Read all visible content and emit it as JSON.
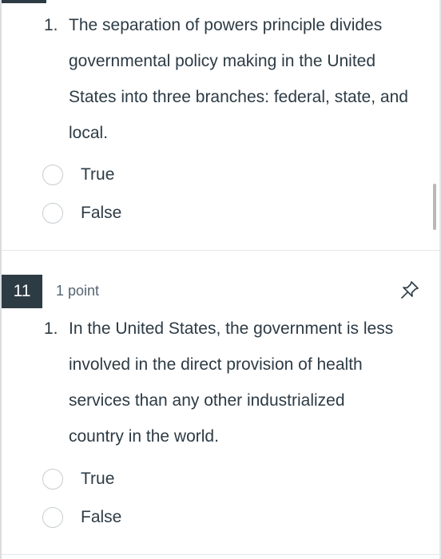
{
  "questions": [
    {
      "item_number": "1.",
      "lines": [
        "The separation of powers principle divides",
        "governmental policy making in the United",
        "States into three branches: federal, state, and",
        "local."
      ],
      "options": [
        "True",
        "False"
      ]
    },
    {
      "badge": "11",
      "points": "1 point",
      "pin_icon": "pin-icon",
      "item_number": "1.",
      "lines": [
        "In the United States, the government is less",
        "involved in the direct provision of health",
        "services than any other industrialized",
        "country in the world."
      ],
      "options": [
        "True",
        "False"
      ]
    }
  ]
}
